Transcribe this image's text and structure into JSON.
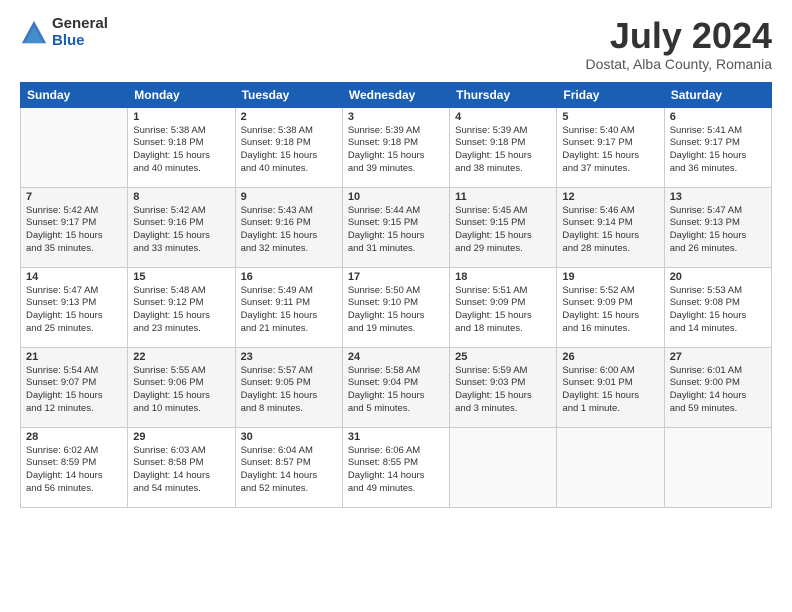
{
  "header": {
    "logo_general": "General",
    "logo_blue": "Blue",
    "month_year": "July 2024",
    "location": "Dostat, Alba County, Romania"
  },
  "calendar": {
    "headers": [
      "Sunday",
      "Monday",
      "Tuesday",
      "Wednesday",
      "Thursday",
      "Friday",
      "Saturday"
    ],
    "weeks": [
      [
        {
          "day": "",
          "info": ""
        },
        {
          "day": "1",
          "info": "Sunrise: 5:38 AM\nSunset: 9:18 PM\nDaylight: 15 hours\nand 40 minutes."
        },
        {
          "day": "2",
          "info": "Sunrise: 5:38 AM\nSunset: 9:18 PM\nDaylight: 15 hours\nand 40 minutes."
        },
        {
          "day": "3",
          "info": "Sunrise: 5:39 AM\nSunset: 9:18 PM\nDaylight: 15 hours\nand 39 minutes."
        },
        {
          "day": "4",
          "info": "Sunrise: 5:39 AM\nSunset: 9:18 PM\nDaylight: 15 hours\nand 38 minutes."
        },
        {
          "day": "5",
          "info": "Sunrise: 5:40 AM\nSunset: 9:17 PM\nDaylight: 15 hours\nand 37 minutes."
        },
        {
          "day": "6",
          "info": "Sunrise: 5:41 AM\nSunset: 9:17 PM\nDaylight: 15 hours\nand 36 minutes."
        }
      ],
      [
        {
          "day": "7",
          "info": "Sunrise: 5:42 AM\nSunset: 9:17 PM\nDaylight: 15 hours\nand 35 minutes."
        },
        {
          "day": "8",
          "info": "Sunrise: 5:42 AM\nSunset: 9:16 PM\nDaylight: 15 hours\nand 33 minutes."
        },
        {
          "day": "9",
          "info": "Sunrise: 5:43 AM\nSunset: 9:16 PM\nDaylight: 15 hours\nand 32 minutes."
        },
        {
          "day": "10",
          "info": "Sunrise: 5:44 AM\nSunset: 9:15 PM\nDaylight: 15 hours\nand 31 minutes."
        },
        {
          "day": "11",
          "info": "Sunrise: 5:45 AM\nSunset: 9:15 PM\nDaylight: 15 hours\nand 29 minutes."
        },
        {
          "day": "12",
          "info": "Sunrise: 5:46 AM\nSunset: 9:14 PM\nDaylight: 15 hours\nand 28 minutes."
        },
        {
          "day": "13",
          "info": "Sunrise: 5:47 AM\nSunset: 9:13 PM\nDaylight: 15 hours\nand 26 minutes."
        }
      ],
      [
        {
          "day": "14",
          "info": "Sunrise: 5:47 AM\nSunset: 9:13 PM\nDaylight: 15 hours\nand 25 minutes."
        },
        {
          "day": "15",
          "info": "Sunrise: 5:48 AM\nSunset: 9:12 PM\nDaylight: 15 hours\nand 23 minutes."
        },
        {
          "day": "16",
          "info": "Sunrise: 5:49 AM\nSunset: 9:11 PM\nDaylight: 15 hours\nand 21 minutes."
        },
        {
          "day": "17",
          "info": "Sunrise: 5:50 AM\nSunset: 9:10 PM\nDaylight: 15 hours\nand 19 minutes."
        },
        {
          "day": "18",
          "info": "Sunrise: 5:51 AM\nSunset: 9:09 PM\nDaylight: 15 hours\nand 18 minutes."
        },
        {
          "day": "19",
          "info": "Sunrise: 5:52 AM\nSunset: 9:09 PM\nDaylight: 15 hours\nand 16 minutes."
        },
        {
          "day": "20",
          "info": "Sunrise: 5:53 AM\nSunset: 9:08 PM\nDaylight: 15 hours\nand 14 minutes."
        }
      ],
      [
        {
          "day": "21",
          "info": "Sunrise: 5:54 AM\nSunset: 9:07 PM\nDaylight: 15 hours\nand 12 minutes."
        },
        {
          "day": "22",
          "info": "Sunrise: 5:55 AM\nSunset: 9:06 PM\nDaylight: 15 hours\nand 10 minutes."
        },
        {
          "day": "23",
          "info": "Sunrise: 5:57 AM\nSunset: 9:05 PM\nDaylight: 15 hours\nand 8 minutes."
        },
        {
          "day": "24",
          "info": "Sunrise: 5:58 AM\nSunset: 9:04 PM\nDaylight: 15 hours\nand 5 minutes."
        },
        {
          "day": "25",
          "info": "Sunrise: 5:59 AM\nSunset: 9:03 PM\nDaylight: 15 hours\nand 3 minutes."
        },
        {
          "day": "26",
          "info": "Sunrise: 6:00 AM\nSunset: 9:01 PM\nDaylight: 15 hours\nand 1 minute."
        },
        {
          "day": "27",
          "info": "Sunrise: 6:01 AM\nSunset: 9:00 PM\nDaylight: 14 hours\nand 59 minutes."
        }
      ],
      [
        {
          "day": "28",
          "info": "Sunrise: 6:02 AM\nSunset: 8:59 PM\nDaylight: 14 hours\nand 56 minutes."
        },
        {
          "day": "29",
          "info": "Sunrise: 6:03 AM\nSunset: 8:58 PM\nDaylight: 14 hours\nand 54 minutes."
        },
        {
          "day": "30",
          "info": "Sunrise: 6:04 AM\nSunset: 8:57 PM\nDaylight: 14 hours\nand 52 minutes."
        },
        {
          "day": "31",
          "info": "Sunrise: 6:06 AM\nSunset: 8:55 PM\nDaylight: 14 hours\nand 49 minutes."
        },
        {
          "day": "",
          "info": ""
        },
        {
          "day": "",
          "info": ""
        },
        {
          "day": "",
          "info": ""
        }
      ]
    ]
  }
}
